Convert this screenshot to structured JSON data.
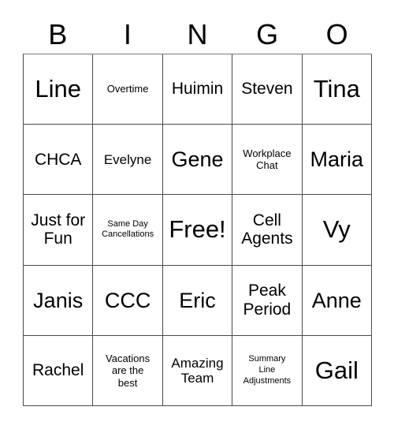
{
  "header": {
    "letters": [
      "B",
      "I",
      "N",
      "G",
      "O"
    ]
  },
  "colors": {
    "background": "#ffffff",
    "text": "#000000",
    "grid_line": "#4a4a4a"
  },
  "grid": [
    [
      {
        "text": "Line"
      },
      {
        "text": "Overtime"
      },
      {
        "text": "Huimin"
      },
      {
        "text": "Steven"
      },
      {
        "text": "Tina"
      }
    ],
    [
      {
        "text": "CHCA"
      },
      {
        "text": "Evelyne"
      },
      {
        "text": "Gene"
      },
      {
        "text": "Workplace\nChat"
      },
      {
        "text": "Maria"
      }
    ],
    [
      {
        "text": "Just for\nFun"
      },
      {
        "text": "Same Day\nCancellations"
      },
      {
        "text": "Free!"
      },
      {
        "text": "Cell\nAgents"
      },
      {
        "text": "Vy"
      }
    ],
    [
      {
        "text": "Janis"
      },
      {
        "text": "CCC"
      },
      {
        "text": "Eric"
      },
      {
        "text": "Peak\nPeriod"
      },
      {
        "text": "Anne"
      }
    ],
    [
      {
        "text": "Rachel"
      },
      {
        "text": "Vacations\nare the\nbest"
      },
      {
        "text": "Amazing\nTeam"
      },
      {
        "text": "Summary\nLine\nAdjustments"
      },
      {
        "text": "Gail"
      }
    ]
  ]
}
